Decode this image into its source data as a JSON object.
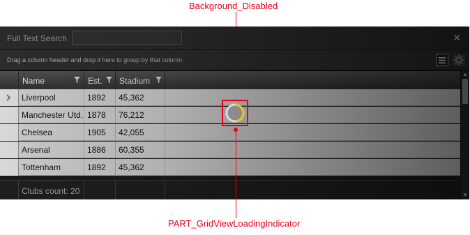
{
  "annotations": {
    "top_label": "Background_Disabled",
    "bottom_label": "PART_GridViewLoadingIndicator",
    "color": "#e8001c"
  },
  "search": {
    "label": "Full Text Search",
    "value": "",
    "close_icon": "close-icon"
  },
  "group_panel": {
    "hint": "Drag a column header and drop it here to group by that column",
    "menu_icon": "menu-icon",
    "settings_icon": "gear-icon"
  },
  "columns": [
    {
      "label": "Name",
      "filter_icon": "filter-icon"
    },
    {
      "label": "Est.",
      "filter_icon": "filter-icon"
    },
    {
      "label": "Stadium",
      "filter_icon": "filter-icon"
    }
  ],
  "rows": [
    {
      "name": "Liverpool",
      "est": "1892",
      "stadium": "45,362",
      "current": true
    },
    {
      "name": "Manchester Utd.",
      "est": "1878",
      "stadium": "76,212",
      "current": false
    },
    {
      "name": "Chelsea",
      "est": "1905",
      "stadium": "42,055",
      "current": false
    },
    {
      "name": "Arsenal",
      "est": "1886",
      "stadium": "60,355",
      "current": false
    },
    {
      "name": "Tottenham",
      "est": "1892",
      "stadium": "45,362",
      "current": false
    }
  ],
  "footer": {
    "text": "Clubs count: 20"
  },
  "loading_indicator": {
    "icon": "loading-spinner-icon",
    "accent_color": "#f0c419"
  }
}
